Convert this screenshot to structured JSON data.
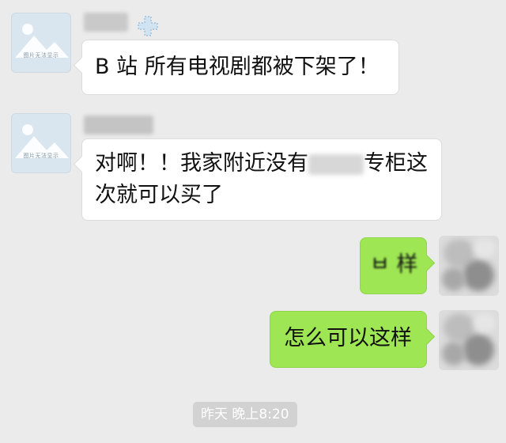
{
  "messages": [
    {
      "side": "left",
      "avatar": "placeholder-image-icon",
      "avatar_caption": "图片无法显示",
      "text": "B 站 所有电视剧都被下架了！"
    },
    {
      "side": "left",
      "avatar": "placeholder-image-icon",
      "avatar_caption": "图片无法显示",
      "text_line1_before": "对啊！！我家附近没有",
      "text_line1_after": "专柜这",
      "text_line2": "次就可以买了"
    },
    {
      "side": "right",
      "avatar": "blurred-avatar",
      "text": "ㅂ 样"
    },
    {
      "side": "right",
      "avatar": "blurred-avatar",
      "text": "怎么可以这样"
    }
  ],
  "timestamp": "昨天 晚上8:20",
  "colors": {
    "background": "#ebebeb",
    "incoming_bubble": "#ffffff",
    "outgoing_bubble": "#9ee653",
    "timestamp_bg": "#d2d2d2"
  }
}
